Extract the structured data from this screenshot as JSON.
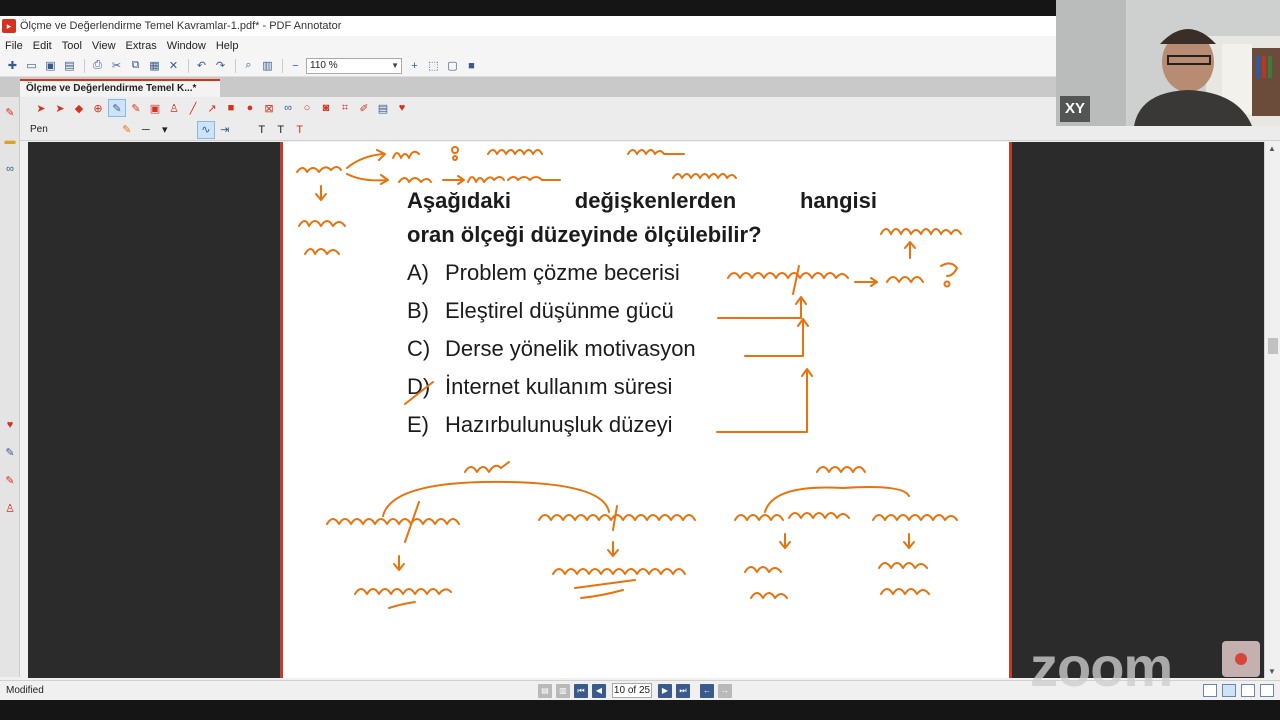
{
  "window": {
    "title": "Ölçme ve Değerlendirme Temel Kavramlar-1.pdf* - PDF Annotator"
  },
  "menu": [
    "File",
    "Edit",
    "Tool",
    "View",
    "Extras",
    "Window",
    "Help"
  ],
  "toolbar": {
    "zoom_value": "110 %"
  },
  "tab": {
    "label": "Ölçme ve Değerlendirme Temel K...*"
  },
  "annot": {
    "tool_label": "Pen"
  },
  "question": {
    "line1": [
      "Aşağıdaki",
      "değişkenlerden",
      "hangisi"
    ],
    "line2": "oran ölçeği düzeyinde ölçülebilir?",
    "options": [
      {
        "letter": "A)",
        "text": "Problem çözme becerisi"
      },
      {
        "letter": "B)",
        "text": "Eleştirel düşünme gücü"
      },
      {
        "letter": "C)",
        "text": "Derse yönelik motivasyon"
      },
      {
        "letter": "D)",
        "text": "İnternet kullanım süresi"
      },
      {
        "letter": "E)",
        "text": "Hazırbulunuşluk düzeyi"
      }
    ]
  },
  "status": {
    "text": "Modified",
    "page_indicator": "10 of 25"
  },
  "video": {
    "participant_initials": "XY",
    "logo_text": "zoom"
  },
  "colors": {
    "accent": "#d6301f",
    "ink": "#e8720c"
  }
}
